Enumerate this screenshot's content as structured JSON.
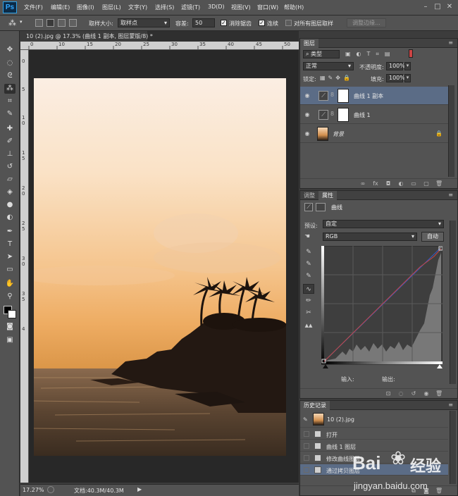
{
  "app": {
    "logo": "Ps"
  },
  "menu": [
    "文件(F)",
    "编辑(E)",
    "图像(I)",
    "图层(L)",
    "文字(Y)",
    "选择(S)",
    "滤镜(T)",
    "3D(D)",
    "视图(V)",
    "窗口(W)",
    "帮助(H)"
  ],
  "options": {
    "sample_size_label": "取样大小:",
    "sample_size_value": "取样点",
    "tolerance_label": "容差:",
    "tolerance_value": "50",
    "antialias_label": "消除锯齿",
    "contiguous_label": "连续",
    "all_layers_label": "对所有图层取样",
    "refine_edge_label": "调整边缘..."
  },
  "document": {
    "tab_title": "10 (2).jpg @ 17.3% (曲线 1 副本, 图层蒙版/8) *",
    "zoom": "17.27%",
    "doc_size": "文档:40.3M/40.3M",
    "ruler_h": [
      "0",
      "10",
      "15",
      "20",
      "25",
      "30",
      "35",
      "40",
      "45",
      "50"
    ],
    "ruler_v": [
      "0",
      "5",
      "1",
      "0",
      "1",
      "5",
      "2",
      "0",
      "2",
      "5",
      "3",
      "0",
      "3",
      "5",
      "4"
    ]
  },
  "layers_panel": {
    "tab": "图层",
    "filter_kind": "类型",
    "blend_mode": "正常",
    "opacity_label": "不透明度:",
    "opacity_value": "100%",
    "lock_label": "锁定:",
    "fill_label": "填充:",
    "fill_value": "100%",
    "layers": [
      {
        "name": "曲线 1 副本",
        "selected": true
      },
      {
        "name": "曲线 1",
        "selected": false
      },
      {
        "name": "背景",
        "selected": false
      }
    ]
  },
  "properties_panel": {
    "tabs": [
      "调整",
      "属性"
    ],
    "title": "曲线",
    "preset_label": "预设:",
    "preset_value": "自定",
    "channel_value": "RGB",
    "auto_label": "自动",
    "input_label": "输入:",
    "output_label": "输出:"
  },
  "history_panel": {
    "tab": "历史记录",
    "snapshot_name": "10 (2).jpg",
    "items": [
      "打开",
      "曲线 1 图层",
      "修改曲线图层",
      "通过拷贝图层"
    ]
  },
  "watermark": {
    "brand": "Bai",
    "brand2": "经验",
    "url": "jingyan.baidu.com"
  },
  "colors": {
    "accent": "#31a8ff",
    "selection": "#5b6c86",
    "panel": "#535353"
  }
}
